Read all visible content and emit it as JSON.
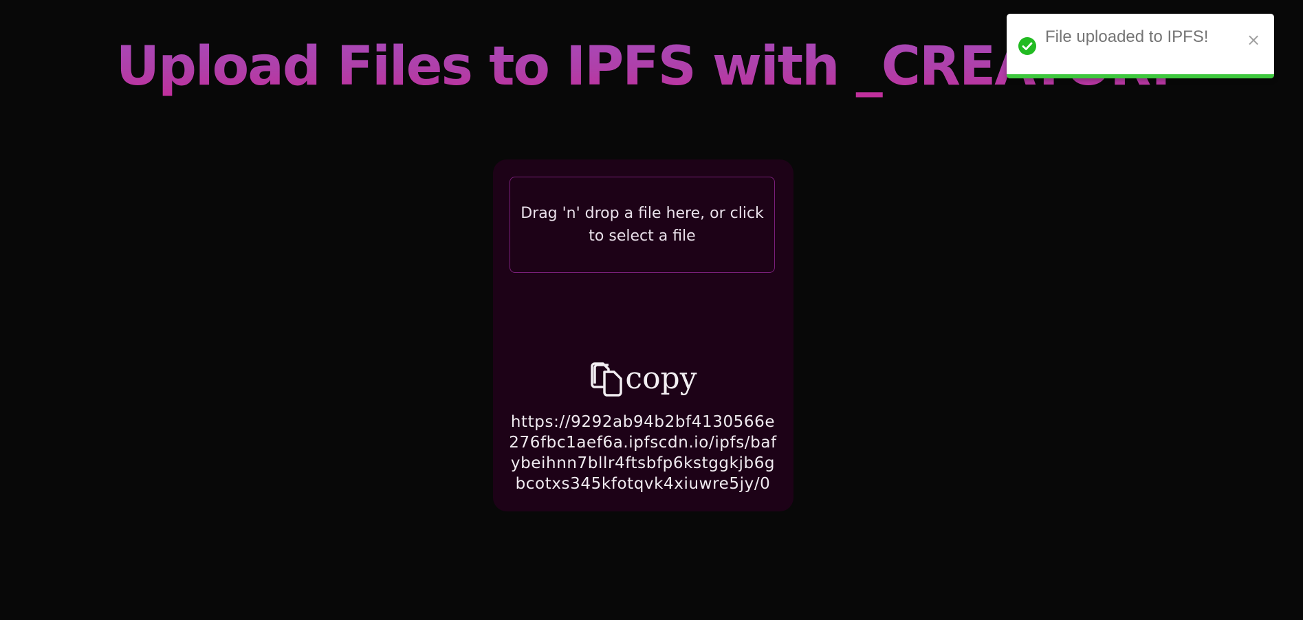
{
  "header": {
    "title": "Upload Files to IPFS with _CREATOR."
  },
  "uploader": {
    "dropzone_text": "Drag 'n' drop a file here, or click to select a file",
    "copy_icon": "copy-icon",
    "copy_label": "copy",
    "link": "https://9292ab94b2bf4130566e276fbc1aef6a.ipfscdn.io/ipfs/bafybeihnn7bllr4ftsbfp6kstggkjb6gbcotxs345kfotqvk4xiuwre5jy/0"
  },
  "toast": {
    "message": "File uploaded to IPFS!",
    "icon": "check-circle-icon",
    "close_icon": "close-icon",
    "close_symbol": "×",
    "progress": 1.0,
    "accent_color": "#3ec83e"
  },
  "colors": {
    "background": "#080808",
    "card": "#1d0217",
    "dropzone_border": "#7a1f7a",
    "title_gradient": [
      "#a54bbd",
      "#c62a98"
    ]
  }
}
